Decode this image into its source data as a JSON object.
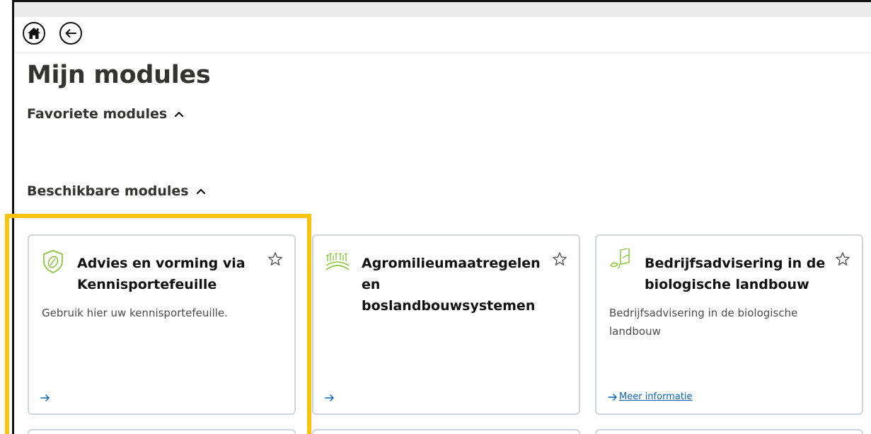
{
  "page": {
    "title": "Mijn modules",
    "accent_color": "#ffc20e",
    "link_color": "#0a63bf"
  },
  "nav": {
    "home_icon": "home-icon",
    "back_icon": "arrow-left-icon"
  },
  "sections": {
    "favorites": {
      "label": "Favoriete modules",
      "icon": "chevron-up-icon"
    },
    "available": {
      "label": "Beschikbare modules",
      "icon": "chevron-up-icon"
    }
  },
  "modules": [
    {
      "title": "Advies en vorming via Kennisportefeuille",
      "description": "Gebruik hier uw kennisportefeuille.",
      "icon": "leaf-shield-icon",
      "link_label": "",
      "favorite_icon": "star-outline-icon"
    },
    {
      "title": "Agromilieumaatregelen en boslandbouwsystemen",
      "description": "",
      "icon": "field-crops-icon",
      "link_label": "",
      "favorite_icon": "star-outline-icon"
    },
    {
      "title": "Bedrijfsadvisering in de biologische landbouw",
      "description": "Bedrijfsadvisering in de biologische landbouw",
      "icon": "seedling-book-icon",
      "link_label": "Meer informatie",
      "favorite_icon": "star-outline-icon"
    }
  ]
}
